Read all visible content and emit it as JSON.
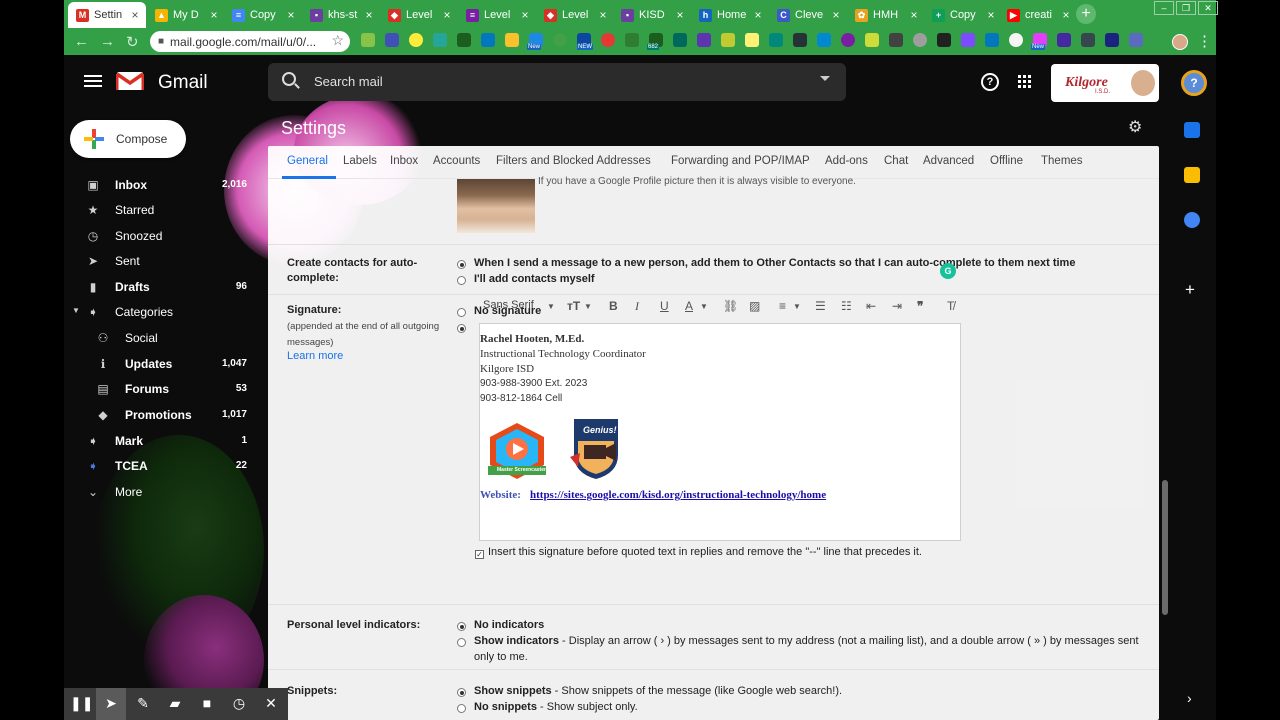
{
  "browser": {
    "tabs": [
      {
        "title": "Settin",
        "icon": "gmail-icon",
        "color": "#d93025",
        "glyph": "M"
      },
      {
        "title": "My D",
        "icon": "drive-icon",
        "color": "#f4b400",
        "glyph": "▲"
      },
      {
        "title": "Copy",
        "icon": "docs-icon",
        "color": "#4285f4",
        "glyph": "≡"
      },
      {
        "title": "khs-st",
        "icon": "classroom-icon",
        "color": "#6a3fa0",
        "glyph": "▪"
      },
      {
        "title": "Level",
        "icon": "edpuzzle-icon",
        "color": "#d93025",
        "glyph": "◆"
      },
      {
        "title": "Level",
        "icon": "forms-icon",
        "color": "#7b1fa2",
        "glyph": "≡"
      },
      {
        "title": "Level",
        "icon": "edpuzzle-icon",
        "color": "#d93025",
        "glyph": "◆"
      },
      {
        "title": "KISD",
        "icon": "classroom-icon",
        "color": "#6a3fa0",
        "glyph": "▪"
      },
      {
        "title": "Home",
        "icon": "sites-icon",
        "color": "#1565c0",
        "glyph": "h"
      },
      {
        "title": "Cleve",
        "icon": "clever-icon",
        "color": "#3c59c9",
        "glyph": "C"
      },
      {
        "title": "HMH",
        "icon": "hmh-icon",
        "color": "#e8a21d",
        "glyph": "✿"
      },
      {
        "title": "Copy",
        "icon": "sheets-icon",
        "color": "#0f9d58",
        "glyph": "+"
      },
      {
        "title": "creati",
        "icon": "youtube-icon",
        "color": "#ff0000",
        "glyph": "▶"
      }
    ],
    "url": "mail.google.com/mail/u/0/...",
    "ext_badges": {
      "a": "New",
      "b": "NEW",
      "c": "682",
      "d": "New"
    }
  },
  "gmail": {
    "brand": "Gmail",
    "search_placeholder": "Search mail",
    "help_glyph": "?",
    "org_logo": "Kilgore",
    "org_sub": "I.S.D.",
    "compose_label": "Compose",
    "nav": [
      {
        "label": "Inbox",
        "count": "2,016",
        "bold": true,
        "icon": "inbox-icon"
      },
      {
        "label": "Starred",
        "count": "",
        "bold": false,
        "icon": "star-icon"
      },
      {
        "label": "Snoozed",
        "count": "",
        "bold": false,
        "icon": "clock-icon"
      },
      {
        "label": "Sent",
        "count": "",
        "bold": false,
        "icon": "send-icon"
      },
      {
        "label": "Drafts",
        "count": "96",
        "bold": true,
        "icon": "draft-icon"
      },
      {
        "label": "Categories",
        "count": "",
        "bold": false,
        "icon": "label-icon"
      },
      {
        "label": "Social",
        "count": "",
        "bold": false,
        "icon": "people-icon"
      },
      {
        "label": "Updates",
        "count": "1,047",
        "bold": true,
        "icon": "info-icon"
      },
      {
        "label": "Forums",
        "count": "53",
        "bold": true,
        "icon": "forum-icon"
      },
      {
        "label": "Promotions",
        "count": "1,017",
        "bold": true,
        "icon": "tag-icon"
      },
      {
        "label": "Mark",
        "count": "1",
        "bold": true,
        "icon": "label-icon"
      },
      {
        "label": "TCEA",
        "count": "22",
        "bold": true,
        "icon": "label-icon"
      },
      {
        "label": "More",
        "count": "",
        "bold": false,
        "icon": "chevron-down-icon"
      }
    ]
  },
  "settings": {
    "title": "Settings",
    "tabs": [
      "General",
      "Labels",
      "Inbox",
      "Accounts",
      "Filters and Blocked Addresses",
      "Forwarding and POP/IMAP",
      "Add-ons",
      "Chat",
      "Advanced",
      "Offline",
      "Themes"
    ],
    "picture_note": "If you have a Google Profile picture then it is always visible to everyone.",
    "autocomplete": {
      "label": "Create contacts for auto-complete:",
      "opt1": "When I send a message to a new person, add them to Other Contacts so that I can auto-complete to them next time",
      "opt2": "I'll add contacts myself"
    },
    "signature": {
      "label": "Signature:",
      "sublabel": "(appended at the end of all outgoing messages)",
      "learn_more": "Learn more",
      "opt_none": "No signature",
      "font": "Sans Serif",
      "lines": [
        "Rachel Hooten, M.Ed.",
        "Instructional Technology Coordinator",
        "Kilgore ISD",
        "903-988-3900 Ext. 2023",
        "903-812-1864 Cell"
      ],
      "badge1_text": "Master Screencaster",
      "badge2_text": "Genius!",
      "website_label": "Website:",
      "website_url": "https://sites.google.com/kisd.org/instructional-technology/home",
      "insert_label": "Insert this signature before quoted text in replies and remove the \"--\" line that precedes it."
    },
    "indicators": {
      "label": "Personal level indicators:",
      "opt1": "No indicators",
      "opt2": "Show indicators",
      "opt2_desc": " - Display an arrow ( › ) by messages sent to my address (not a mailing list), and a double arrow ( » ) by messages sent only to me."
    },
    "snippets": {
      "label": "Snippets:",
      "opt1": "Show snippets",
      "opt1_desc": " - Show snippets of the message (like Google web search!).",
      "opt2": "No snippets",
      "opt2_desc": " - Show subject only."
    }
  },
  "colors": {
    "chrome": "#33a047",
    "accent": "#1a73e8",
    "link": "#1a0dab"
  }
}
